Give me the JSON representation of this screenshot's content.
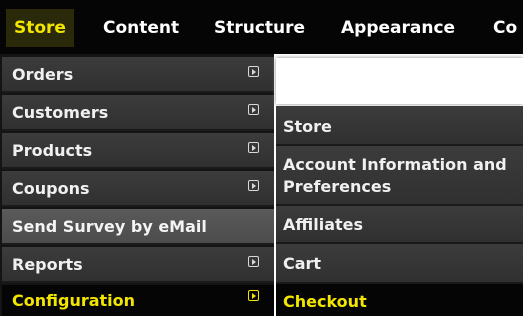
{
  "top_nav": {
    "tabs": [
      {
        "label": "Store",
        "active": true
      },
      {
        "label": "Content"
      },
      {
        "label": "Structure"
      },
      {
        "label": "Appearance"
      },
      {
        "label": "Co"
      }
    ]
  },
  "store_menu": {
    "items": [
      {
        "label": "Orders",
        "has_submenu": true
      },
      {
        "label": "Customers",
        "has_submenu": true
      },
      {
        "label": "Products",
        "has_submenu": true
      },
      {
        "label": "Coupons",
        "has_submenu": true
      },
      {
        "label": "Send Survey by eMail",
        "has_submenu": false
      },
      {
        "label": "Reports",
        "has_submenu": true
      },
      {
        "label": "Configuration",
        "has_submenu": true,
        "active": true
      }
    ]
  },
  "configuration_submenu": {
    "items": [
      {
        "label": "Store"
      },
      {
        "label_line1": "Account Information and",
        "label_line2": "Preferences"
      },
      {
        "label": "Affiliates"
      },
      {
        "label": "Cart"
      },
      {
        "label": "Checkout",
        "active": true
      }
    ]
  },
  "colors": {
    "bar_background": "#050505",
    "menu_item": "#363636",
    "active_text": "#f2e500",
    "text": "#f0f0f0"
  },
  "icons": {
    "submenu_arrow": "arrow-right-box-icon"
  }
}
